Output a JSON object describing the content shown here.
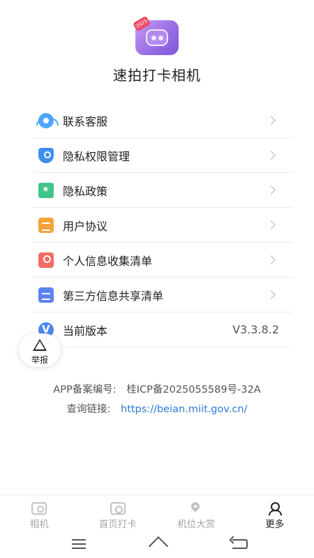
{
  "app": {
    "name": "速拍打卡相机",
    "logo_badge": "2025"
  },
  "menu": {
    "items": [
      {
        "label": "联系客服",
        "icon": "customer-service-icon"
      },
      {
        "label": "隐私权限管理",
        "icon": "shield-key-icon"
      },
      {
        "label": "隐私政策",
        "icon": "bookmark-star-icon"
      },
      {
        "label": "用户协议",
        "icon": "document-icon"
      },
      {
        "label": "个人信息收集清单",
        "icon": "person-card-icon"
      },
      {
        "label": "第三方信息共享清单",
        "icon": "list-document-icon"
      }
    ],
    "version": {
      "label": "当前版本",
      "value": "V3.3.8.2",
      "icon": "version-icon"
    }
  },
  "report": {
    "label": "举报",
    "icon": "warning-icon"
  },
  "record": {
    "icp_label": "APP备案编号:",
    "icp_value": "桂ICP备2025055589号-32A",
    "query_label": "查询链接:",
    "query_link": "https://beian.miit.gov.cn/",
    "link_color": "#2a7ad9"
  },
  "tabbar": {
    "tabs": [
      {
        "label": "相机",
        "icon": "camera-icon",
        "active": false
      },
      {
        "label": "首页打卡",
        "icon": "photo-icon",
        "active": false
      },
      {
        "label": "机位大赏",
        "icon": "location-pin-icon",
        "active": false
      },
      {
        "label": "更多",
        "icon": "user-icon",
        "active": true
      }
    ]
  },
  "system_nav": {
    "buttons": [
      "menu-icon",
      "home-icon",
      "back-icon"
    ]
  }
}
